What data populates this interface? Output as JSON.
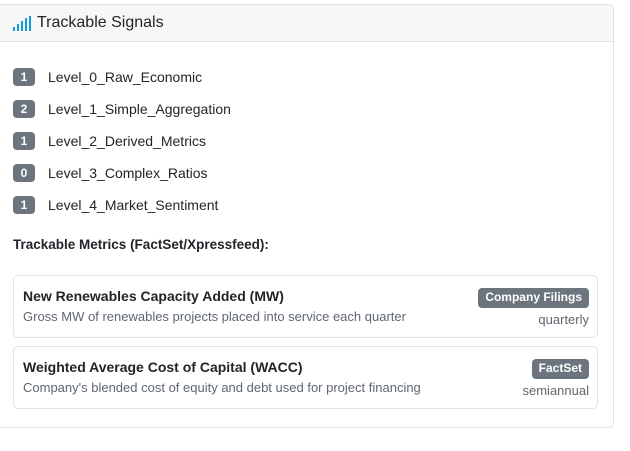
{
  "header": {
    "title": "Trackable Signals",
    "icon": "signal-bars-icon",
    "icon_color": "#0d9ed8"
  },
  "levels": [
    {
      "count": "1",
      "label": "Level_0_Raw_Economic"
    },
    {
      "count": "2",
      "label": "Level_1_Simple_Aggregation"
    },
    {
      "count": "1",
      "label": "Level_2_Derived_Metrics"
    },
    {
      "count": "0",
      "label": "Level_3_Complex_Ratios"
    },
    {
      "count": "1",
      "label": "Level_4_Market_Sentiment"
    }
  ],
  "metrics_heading": "Trackable Metrics (FactSet/Xpressfeed):",
  "metrics": [
    {
      "name": "New Renewables Capacity Added (MW)",
      "description": "Gross MW of renewables projects placed into service each quarter",
      "source": "Company Filings",
      "frequency": "quarterly"
    },
    {
      "name": "Weighted Average Cost of Capital (WACC)",
      "description": "Company's blended cost of equity and debt used for project financing",
      "source": "FactSet",
      "frequency": "semiannual"
    }
  ],
  "colors": {
    "badge": "#6c757d",
    "border": "#dfe2e5",
    "header_bg": "#f7f7f8"
  }
}
